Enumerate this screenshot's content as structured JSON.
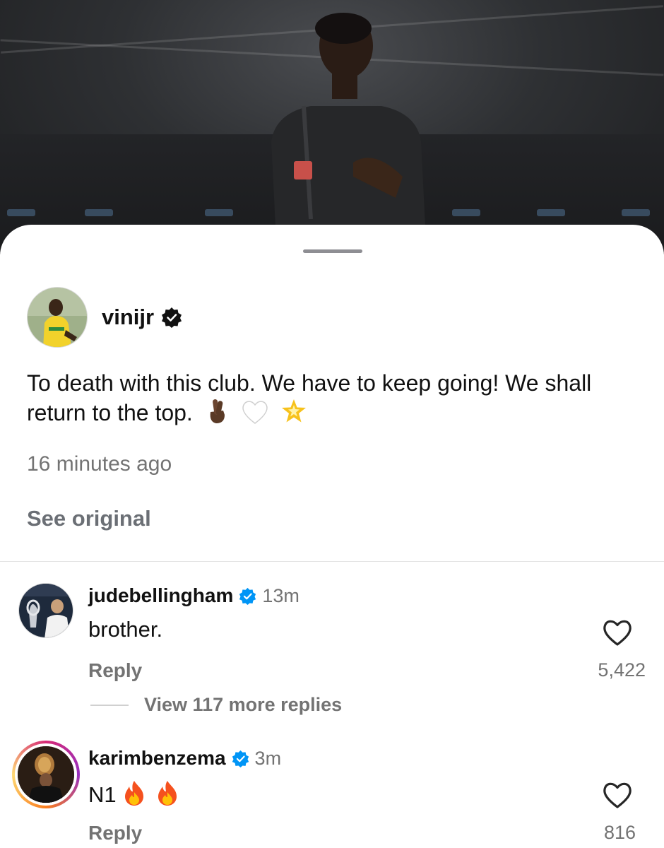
{
  "post": {
    "author": "vinijr",
    "caption_text": "To death with this club. We have to keep going! We shall return to the top.",
    "caption_emojis": [
      "crossed-fingers-dark",
      "white-heart",
      "glowing-star"
    ],
    "timestamp": "16 minutes ago",
    "see_original": "See original"
  },
  "comments": [
    {
      "username": "judebellingham",
      "time": "13m",
      "text": "brother.",
      "reply_label": "Reply",
      "likes": "5,422",
      "view_more_replies": "View 117 more replies"
    },
    {
      "username": "karimbenzema",
      "time": "3m",
      "text": "N1",
      "text_emojis": [
        "fire",
        "fire"
      ],
      "reply_label": "Reply",
      "likes": "816"
    }
  ],
  "icons": {
    "verified": "verified-badge-icon",
    "like": "heart-outline-icon"
  },
  "colors": {
    "verified_blue": "#0095f6",
    "secondary_text": "#737373",
    "story_ring": [
      "#d62976",
      "#962fbf",
      "#fa7e1e",
      "#feda75"
    ]
  }
}
